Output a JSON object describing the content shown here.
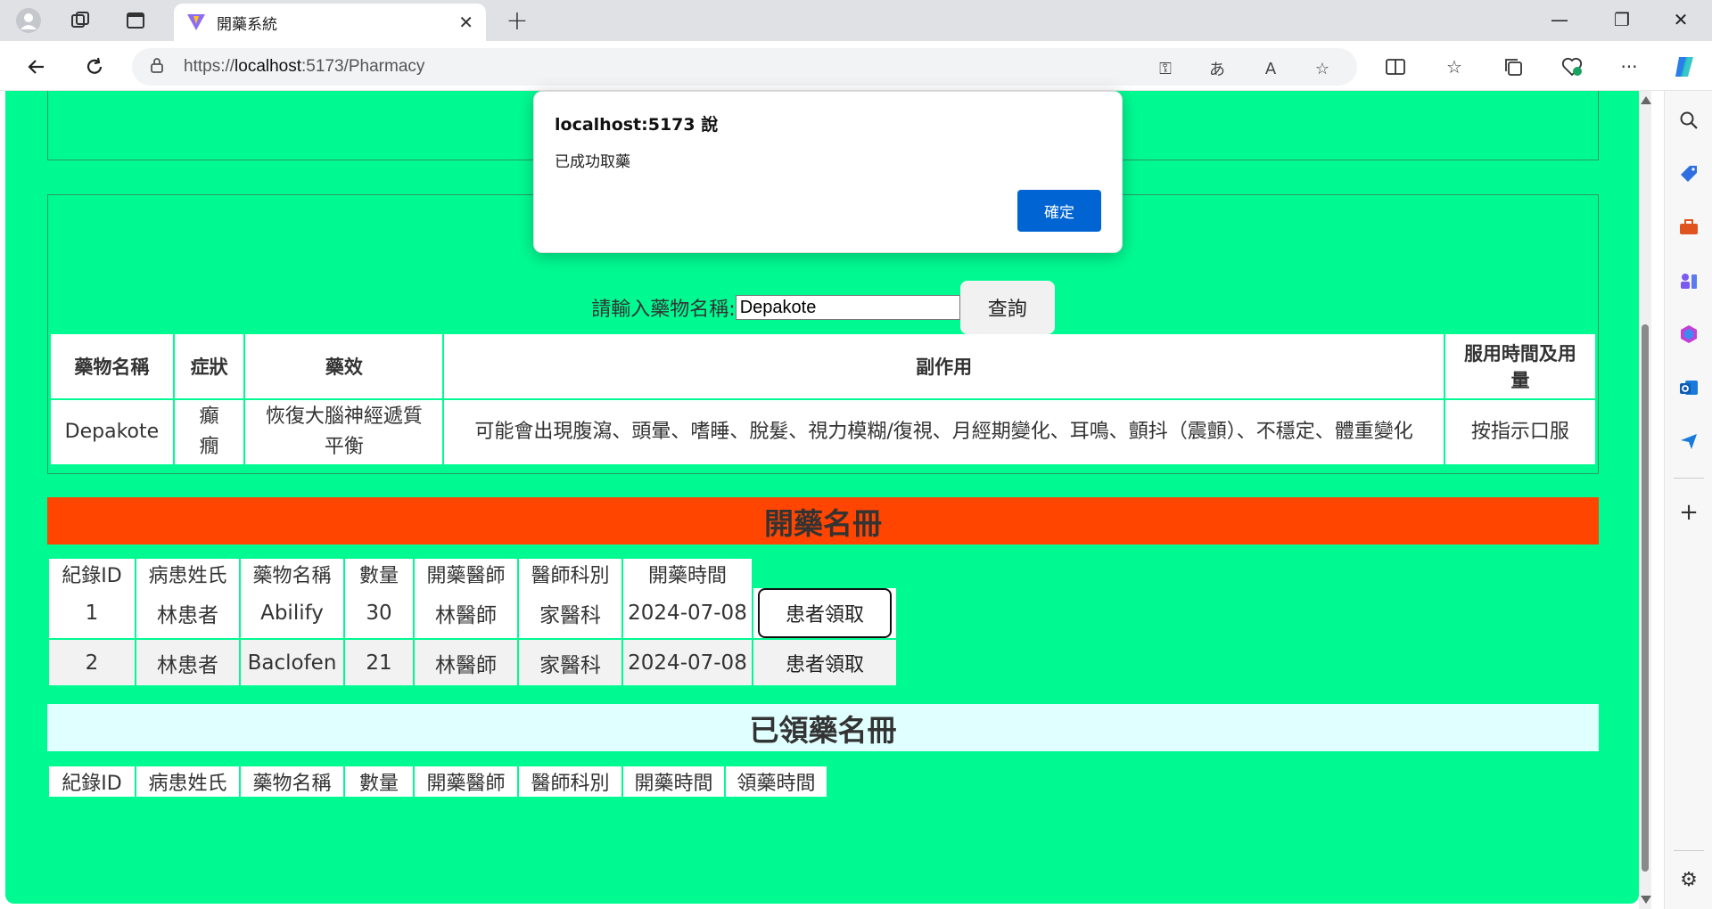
{
  "browser": {
    "tab_title": "開藥系統",
    "url_prefix": "https://",
    "url_host": "localhost",
    "url_rest": ":5173/Pharmacy"
  },
  "icons": {
    "profile": "profile-icon",
    "workspaces": "workspaces-icon",
    "vertical_tabs": "vertical-tabs-icon",
    "back": "back-arrow-icon",
    "refresh": "refresh-icon",
    "lock": "lock-icon",
    "password": "key-icon",
    "translate": "translate-icon",
    "read_aloud": "read-aloud-icon",
    "favorite": "star-icon",
    "split": "split-screen-icon",
    "favorites": "favorites-icon",
    "collections": "collections-icon",
    "health": "browser-essentials-icon",
    "more": "more-icon",
    "copilot": "copilot-icon"
  },
  "search": {
    "label": "請輸入藥物名稱:",
    "value": "Depakote",
    "button": "查詢"
  },
  "drug_table": {
    "headers": [
      "藥物名稱",
      "症狀",
      "藥效",
      "副作用",
      "服用時間及用量"
    ],
    "row": {
      "name": "Depakote",
      "symptom": "癲癇",
      "effect": "恢復大腦神經遞質平衡",
      "side_effects": "可能會出現腹瀉、頭暈、嗜睡、脫髮、視力模糊/復視、月經期變化、耳鳴、顫抖（震顫）、不穩定、體重變化",
      "dosage": "按指示口服"
    }
  },
  "rx_section": {
    "title": "開藥名冊",
    "headers": [
      "紀錄ID",
      "病患姓氏",
      "藥物名稱",
      "數量",
      "開藥醫師",
      "醫師科別",
      "開藥時間"
    ],
    "rows": [
      {
        "id": "1",
        "patient": "林患者",
        "drug": "Abilify",
        "qty": "30",
        "doctor": "林醫師",
        "dept": "家醫科",
        "date": "2024-07-08",
        "action": "患者領取"
      },
      {
        "id": "2",
        "patient": "林患者",
        "drug": "Baclofen",
        "qty": "21",
        "doctor": "林醫師",
        "dept": "家醫科",
        "date": "2024-07-08",
        "action": "患者領取"
      }
    ]
  },
  "picked_section": {
    "title": "已領藥名冊",
    "headers": [
      "紀錄ID",
      "病患姓氏",
      "藥物名稱",
      "數量",
      "開藥醫師",
      "醫師科別",
      "開藥時間",
      "領藥時間"
    ]
  },
  "dialog": {
    "title": "localhost:5173 說",
    "message": "已成功取藥",
    "ok": "確定"
  },
  "colors": {
    "page_bg": "#00fa92",
    "rx_banner": "#ff4500",
    "picked_banner": "#e0ffff",
    "dialog_ok": "#0064d2"
  }
}
